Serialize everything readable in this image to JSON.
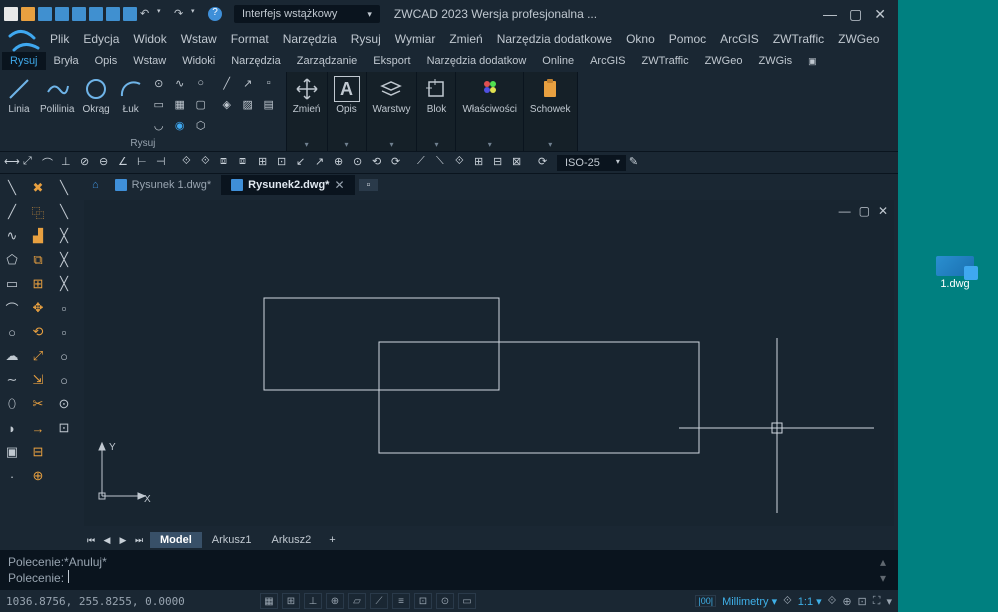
{
  "title": "ZWCAD 2023 Wersja profesjonalna ...",
  "interface_mode": "Interfejs wstążkowy",
  "menu": [
    "Plik",
    "Edycja",
    "Widok",
    "Wstaw",
    "Format",
    "Narzędzia",
    "Rysuj",
    "Wymiar",
    "Zmień",
    "Narzędzia dodatkowe",
    "Okno",
    "Pomoc",
    "ArcGIS",
    "ZWTraffic",
    "ZWGeo"
  ],
  "tabs": [
    "Rysuj",
    "Bryła",
    "Opis",
    "Wstaw",
    "Widoki",
    "Narzędzia",
    "Zarządzanie",
    "Eksport",
    "Narzędzia dodatkow",
    "Online",
    "ArcGIS",
    "ZWTraffic",
    "ZWGeo",
    "ZWGis"
  ],
  "active_tab": 0,
  "ribbon": {
    "draw": {
      "title": "Rysuj",
      "big": [
        {
          "label": "Linia"
        },
        {
          "label": "Polilinia"
        },
        {
          "label": "Okrąg"
        },
        {
          "label": "Łuk"
        }
      ]
    },
    "panels": [
      {
        "label": "Zmień"
      },
      {
        "label": "Opis"
      },
      {
        "label": "Warstwy"
      },
      {
        "label": "Blok"
      },
      {
        "label": "Właściwości"
      },
      {
        "label": "Schowek"
      }
    ]
  },
  "dim_style": "ISO-25",
  "doc_tabs": [
    {
      "name": "Rysunek 1.dwg*",
      "active": false
    },
    {
      "name": "Rysunek2.dwg*",
      "active": true
    }
  ],
  "layout_tabs": [
    "Model",
    "Arkusz1",
    "Arkusz2"
  ],
  "active_layout": 0,
  "cmd": {
    "line1_prefix": "Polecenie: ",
    "line1_text": "*Anuluj*",
    "line2_prefix": "Polecenie: "
  },
  "status": {
    "coords": "1036.8756, 255.8255, 0.0000",
    "units": "Millimetry",
    "scale": "1:1"
  },
  "desktop_file": "1.dwg"
}
